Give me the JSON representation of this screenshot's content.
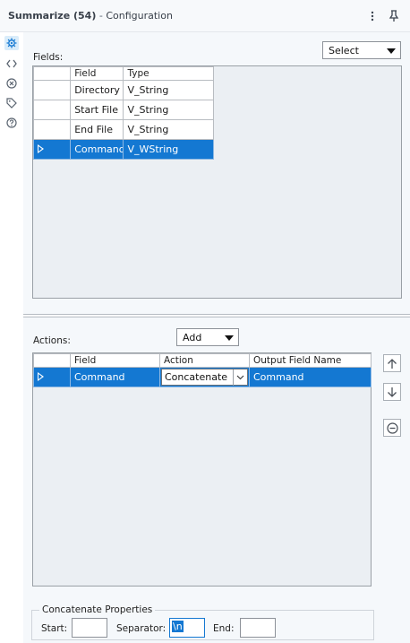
{
  "header": {
    "tool_name": "Summarize (54)",
    "separator": " - ",
    "section": "Configuration",
    "menu_icon": "more-vertical-icon",
    "pin_icon": "pin-icon"
  },
  "rail": {
    "icons": [
      "gear-icon",
      "code-icon",
      "circle-x-icon",
      "tag-icon",
      "help-icon"
    ]
  },
  "fields": {
    "label": "Fields:",
    "select_dropdown": "Select",
    "columns": [
      "",
      "Field",
      "Type"
    ],
    "rows": [
      {
        "field": "Directory",
        "type": "V_String",
        "selected": false
      },
      {
        "field": "Start File",
        "type": "V_String",
        "selected": false
      },
      {
        "field": "End File",
        "type": "V_String",
        "selected": false
      },
      {
        "field": "Command",
        "type": "V_WString",
        "selected": true
      }
    ]
  },
  "actions": {
    "label": "Actions:",
    "add_dropdown": "Add",
    "columns": [
      "",
      "Field",
      "Action",
      "Output Field Name"
    ],
    "rows": [
      {
        "field": "Command",
        "action": "Concatenate",
        "output": "Command",
        "selected": true
      }
    ],
    "side_buttons": [
      "arrow-up-icon",
      "arrow-down-icon",
      "remove-circle-icon"
    ]
  },
  "concatenate": {
    "title": "Concatenate Properties",
    "start_label": "Start:",
    "start_value": "",
    "separator_label": "Separator:",
    "separator_value": "\\n",
    "end_label": "End:",
    "end_value": ""
  },
  "colors": {
    "selection": "#1478d2",
    "panel_bg": "#f5f8fb",
    "grid_bg": "#ebeff3"
  }
}
